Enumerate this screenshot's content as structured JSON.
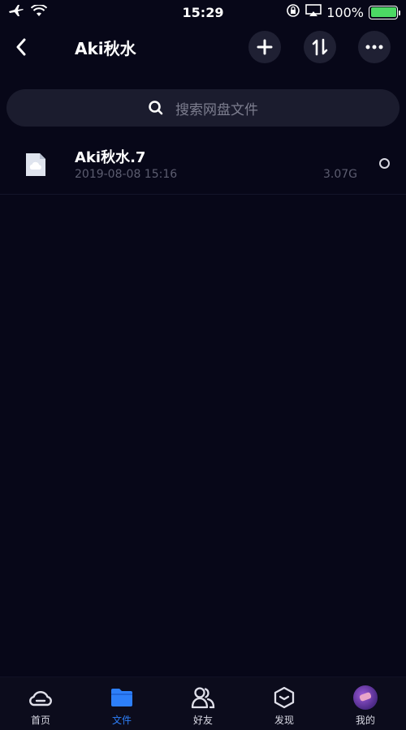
{
  "status_bar": {
    "time": "15:29",
    "battery": "100%",
    "battery_level": 1.0,
    "battery_color": "#4cd964"
  },
  "header": {
    "title": "Aki秋水",
    "back_icon": "chevron-left-icon",
    "add_icon": "plus-icon",
    "sort_icon": "sort-icon",
    "more_icon": "more-horizontal-icon"
  },
  "search": {
    "placeholder": "搜索网盘文件"
  },
  "files": [
    {
      "name": "Aki秋水.7",
      "date": "2019-08-08 15:16",
      "size": "3.07G"
    }
  ],
  "tabs": [
    {
      "label": "首页",
      "icon": "cloud-home-icon",
      "active": false
    },
    {
      "label": "文件",
      "icon": "folder-icon",
      "active": true
    },
    {
      "label": "好友",
      "icon": "friends-icon",
      "active": false
    },
    {
      "label": "发现",
      "icon": "discover-cube-icon",
      "active": false
    },
    {
      "label": "我的",
      "icon": "avatar",
      "active": false
    }
  ],
  "colors": {
    "background": "#070718",
    "accent": "#2d7ff9",
    "button_bg": "#1f2033"
  }
}
